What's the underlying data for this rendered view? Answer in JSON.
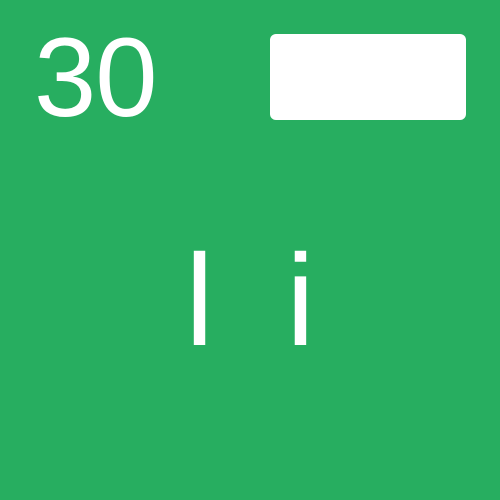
{
  "tile": {
    "background_color": "#27ae60",
    "count_value": "30",
    "center_text": "l i",
    "answer_box_color": "#ffffff"
  }
}
